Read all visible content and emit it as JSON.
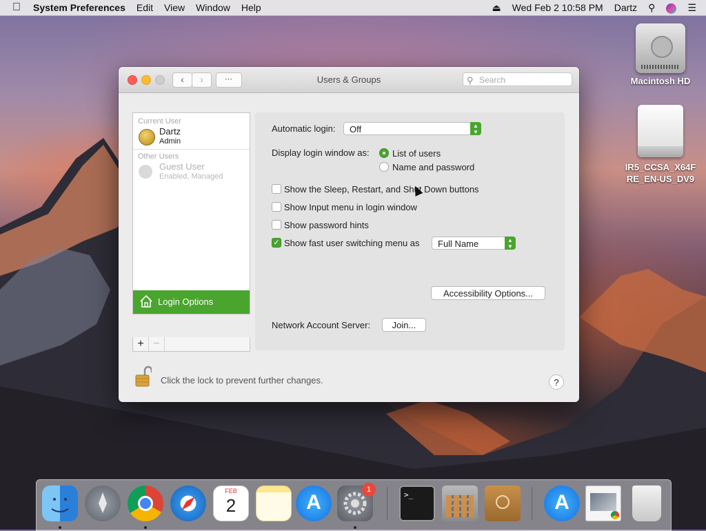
{
  "menubar": {
    "app_name": "System Preferences",
    "menus": [
      "Edit",
      "View",
      "Window",
      "Help"
    ],
    "datetime": "Wed Feb 2  10:58 PM",
    "user": "Dartz"
  },
  "desktop": {
    "icons": [
      {
        "label": "Macintosh HD",
        "icon": "hard-drive-icon"
      },
      {
        "label": "IR5_CCSA_X64FRE_EN-US_DV9",
        "icon": "external-drive-icon"
      }
    ]
  },
  "window": {
    "title": "Users & Groups",
    "search_placeholder": "Search",
    "sidebar": {
      "current_user_header": "Current User",
      "current_user": {
        "name": "Dartz",
        "role": "Admin"
      },
      "other_users_header": "Other Users",
      "other_users": [
        {
          "name": "Guest User",
          "status": "Enabled, Managed"
        }
      ],
      "login_options_label": "Login Options",
      "add_label": "+",
      "remove_label": "−"
    },
    "pane": {
      "automatic_login_label": "Automatic login:",
      "automatic_login_value": "Off",
      "display_login_label": "Display login window as:",
      "display_options": [
        {
          "label": "List of users",
          "selected": true
        },
        {
          "label": "Name and password",
          "selected": false
        }
      ],
      "checkboxes": [
        {
          "label": "Show the Sleep, Restart, and Shut Down buttons",
          "checked": false
        },
        {
          "label": "Show Input menu in login window",
          "checked": false
        },
        {
          "label": "Show password hints",
          "checked": false
        },
        {
          "label": "Show fast user switching menu as",
          "checked": true
        }
      ],
      "fast_user_switch_value": "Full Name",
      "accessibility_button": "Accessibility Options...",
      "network_server_label": "Network Account Server:",
      "join_button": "Join..."
    },
    "lock_text": "Click the lock to prevent further changes.",
    "help_label": "?"
  },
  "dock": {
    "apps": [
      "Finder",
      "Launchpad",
      "Chrome",
      "Safari",
      "Calendar",
      "Notes",
      "App Store",
      "System Preferences",
      "Terminal",
      "Calculator",
      "Contacts",
      "App Store",
      "Preview",
      "Trash"
    ],
    "calendar_month": "FEB",
    "calendar_day": "2",
    "badge_count": "1",
    "accent": "#4aa52e"
  }
}
